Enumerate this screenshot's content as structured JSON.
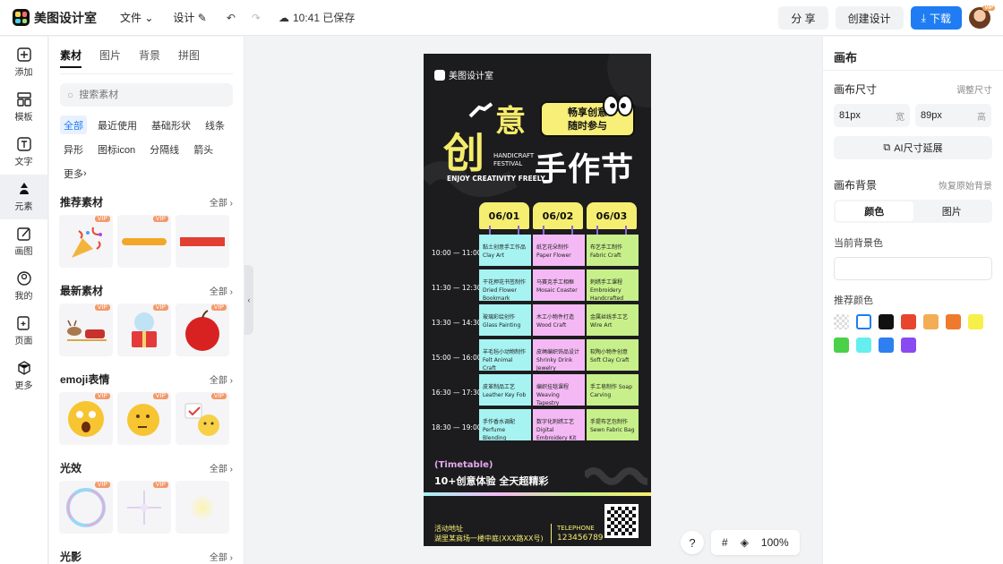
{
  "app": {
    "name": "美图设计室"
  },
  "menu": {
    "file": "文件",
    "design": "设计",
    "saved": "10:41 已保存"
  },
  "top_actions": {
    "share": "分 享",
    "create": "创建设计",
    "download": "下载",
    "avatar_badge": "VIP"
  },
  "rail": [
    {
      "label": "添加",
      "icon": "plus-square-icon"
    },
    {
      "label": "模板",
      "icon": "template-icon"
    },
    {
      "label": "文字",
      "icon": "text-icon"
    },
    {
      "label": "元素",
      "icon": "shapes-icon"
    },
    {
      "label": "画图",
      "icon": "draw-icon"
    },
    {
      "label": "我的",
      "icon": "user-icon"
    },
    {
      "label": "页面",
      "icon": "page-add-icon"
    },
    {
      "label": "更多",
      "icon": "cube-icon"
    }
  ],
  "panel": {
    "tabs": [
      "素材",
      "图片",
      "背景",
      "拼图"
    ],
    "search_placeholder": "搜索素材",
    "chips": [
      "全部",
      "最近使用",
      "基础形状",
      "线条",
      "异形",
      "图标icon",
      "分隔线",
      "箭头",
      "更多"
    ],
    "all": "全部",
    "vip": "VIP",
    "sections": [
      "推荐素材",
      "最新素材",
      "emoji表情",
      "光效",
      "光影"
    ]
  },
  "poster": {
    "logo": "美图设计室",
    "bubble_1": "畅享创意",
    "bubble_2": "随时参与",
    "title_1": "创",
    "title_2": "意",
    "title_3": "手作节",
    "handicraft_1": "HANDICRAFT",
    "handicraft_2": "FESTIVAL",
    "enjoy": "ENJOY CREATIVITY FREELY",
    "dates": [
      "06/01",
      "06/02",
      "06/03"
    ],
    "times": [
      "10:00 — 11:00",
      "11:30 — 12:30",
      "13:30 — 14:30",
      "15:00 — 16:00",
      "16:30 — 17:30",
      "18:30 — 19:00"
    ],
    "cells": [
      [
        "黏土创意手工作品 Clay Art",
        "纸艺花朵制作 Paper Flower",
        "布艺手工制作 Fabric Craft"
      ],
      [
        "干花押花书签制作 Dried Flower Bookmark",
        "马赛克手工相框 Mosaic Coaster",
        "刺绣手工课程 Embroidery Handcrafted"
      ],
      [
        "玻璃彩绘创作 Glass Painting",
        "木工小物件打造 Wood Craft",
        "金属丝线手工艺 Wire Art"
      ],
      [
        "羊毛毡小动物制作 Felt Animal Craft",
        "皮绳编织饰品设计 Shrinky Drink Jewelry",
        "软陶小物件创意 Soft Clay Craft"
      ],
      [
        "皮革制品工艺 Leather Key Fob",
        "编织挂毯课程 Weaving Tapestry",
        "手工皂制作 Soap Carving"
      ],
      [
        "手作香水调配 Perfume Blending",
        "数字化刺绣工艺 Digital Embroidery Kit",
        "手提布艺包制作 Sewn Fabric Bag"
      ]
    ],
    "timetable": "(Timetable)",
    "tagline": "10+创意体验 全天超精彩",
    "addr_label": "活动地址",
    "address": "湖里某商场一楼中庭(XXX路XX号)",
    "tel_label": "TELEPHONE",
    "phone": "123456789"
  },
  "canvas_tools": {
    "help": "?",
    "zoom": "100%"
  },
  "right": {
    "title": "画布",
    "size_label": "画布尺寸",
    "size_adjust": "调整尺寸",
    "width_value": "81px",
    "width_unit": "宽",
    "height_value": "89px",
    "height_unit": "高",
    "ai_extend": "AI尺寸延展",
    "bg_label": "画布背景",
    "bg_reset": "恢复原始背景",
    "seg_color": "颜色",
    "seg_image": "图片",
    "current_bg": "当前背景色",
    "recommend": "推荐颜色",
    "swatches": [
      "transparent",
      "#ffffff",
      "#111111",
      "#e8452e",
      "#f2ad55",
      "#ef7a2e",
      "#f7ef4a",
      "#4bd04a",
      "#66eeee",
      "#2e7ff0",
      "#8a4af2"
    ]
  }
}
